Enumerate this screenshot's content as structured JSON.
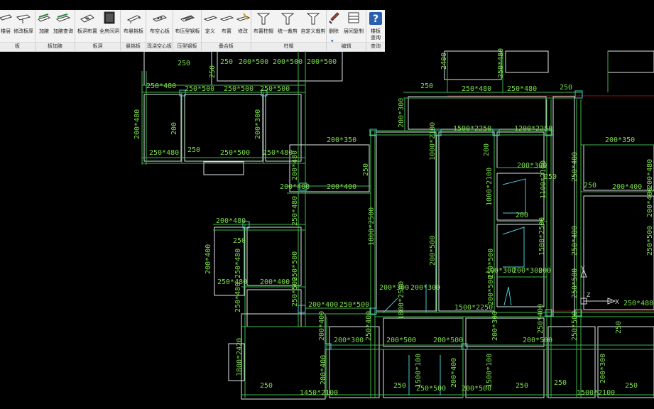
{
  "ribbon": {
    "groups": [
      {
        "label": "板",
        "buttons": [
          {
            "label": "楼层"
          },
          {
            "label": "修改板厚"
          }
        ]
      },
      {
        "label": "板加腋",
        "buttons": [
          {
            "label": "加腋"
          },
          {
            "label": "加腋查询"
          }
        ]
      },
      {
        "label": "板洞",
        "buttons": [
          {
            "label": "板洞布置"
          },
          {
            "label": "全房间洞"
          }
        ]
      },
      {
        "label": "悬挑板",
        "buttons": [
          {
            "label": "布悬挑板"
          }
        ]
      },
      {
        "label": "现浇空心板",
        "buttons": [
          {
            "label": "布空心板"
          }
        ]
      },
      {
        "label": "压型钢板",
        "buttons": [
          {
            "label": "布压型钢板"
          }
        ]
      },
      {
        "label": "叠合板",
        "buttons": [
          {
            "label": "定义"
          },
          {
            "label": "布置"
          },
          {
            "label": "修改"
          }
        ]
      },
      {
        "label": "柱帽",
        "buttons": [
          {
            "label": "布置柱帽"
          },
          {
            "label": "统一裁剪"
          },
          {
            "label": "自定义裁剪"
          }
        ]
      },
      {
        "label": "编辑",
        "buttons": [
          {
            "label": "删除"
          },
          {
            "label": "层间复制"
          }
        ]
      },
      {
        "label": "查询",
        "buttons": [
          {
            "label": "楼板查询"
          }
        ]
      }
    ]
  },
  "drawing": {
    "labels": [
      "200*500",
      "200*500",
      "200*500",
      "250",
      "250",
      "250*480",
      "250*500",
      "250*500",
      "250*500",
      "250*480",
      "250*480",
      "250",
      "250",
      "2400",
      "250",
      "250*480",
      "200*300",
      "1500*2250",
      "1200*2250",
      "200*350",
      "1000*2100",
      "200",
      "200*350",
      "250",
      "200*480",
      "200",
      "200*300",
      "250*480",
      "250",
      "250*480",
      "250*500",
      "200*480",
      "200*400",
      "200*400",
      "250*400",
      "250",
      "200*400",
      "200*300",
      "200*480",
      "1800*2500",
      "200",
      "1000*2100",
      "1100*2100",
      "250*400",
      "200*400",
      "200*480",
      "250*480",
      "250*500",
      "250*480",
      "200*400",
      "250",
      "1500*2500",
      "250*500",
      "250*500",
      "200*400",
      "250*480",
      "200*300",
      "200*500",
      "200*300",
      "200*300",
      "200*300",
      "250*500",
      "200*500",
      "200",
      "250*500",
      "1500*2250",
      "1800*2500",
      "250*480",
      "200*400",
      "250*480",
      "250*500",
      "200*300",
      "200*500",
      "200*500",
      "200*400",
      "1800*2420",
      "200*300",
      "250*400",
      "250*500",
      "250*400",
      "200*500",
      "250",
      "1500*100",
      "200*400",
      "250*500",
      "200*400",
      "1500*100",
      "200*500",
      "250",
      "250",
      "250",
      "1450*2100",
      "250",
      "250",
      "1500*2100",
      "200*300",
      "250"
    ],
    "ucs": {
      "y": "Y",
      "x": "X",
      "z": "Z"
    }
  }
}
